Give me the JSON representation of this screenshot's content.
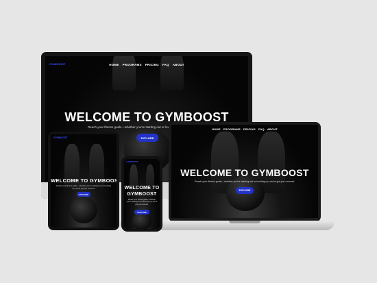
{
  "site": {
    "nav": [
      "HOME",
      "PROGRAMS",
      "PRICING",
      "FAQ",
      "ABOUT"
    ],
    "brand": "GYMBOOST",
    "hero_title": "WELCOME TO GYMBOOST",
    "hero_title_wrapped": [
      "WELCOME TO",
      "GYMBOOST"
    ],
    "hero_subtitle": "Reach your fitness goals—whether you're starting out or leveling up, we've got you covered.",
    "cta": "EXPLORE"
  },
  "colors": {
    "accent": "#2333c8",
    "brand_text": "#3b4bff",
    "background": "#e6e6e6",
    "screen": "#080808"
  }
}
